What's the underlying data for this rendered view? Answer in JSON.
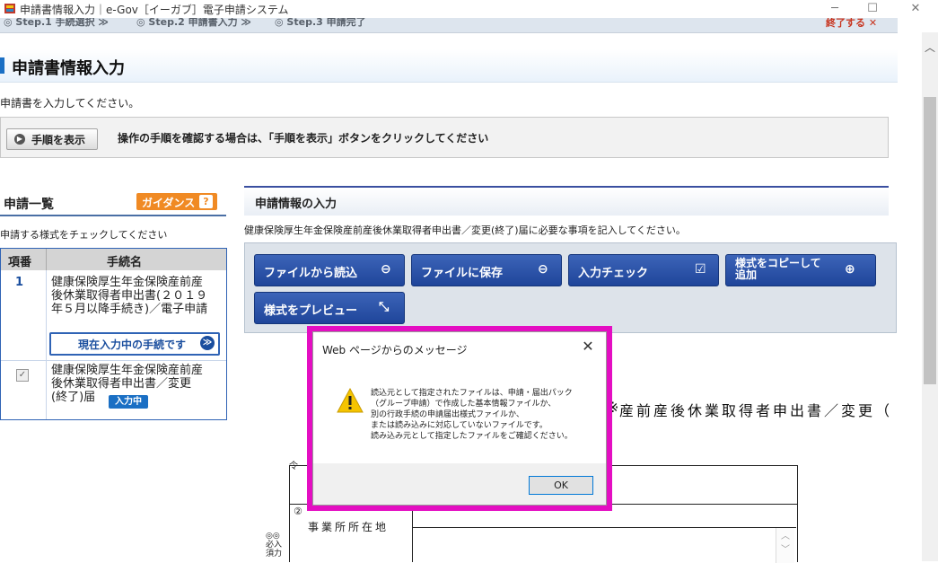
{
  "window": {
    "title": "申請書情報入力｜e-Gov［イーガブ］電子申請システム",
    "controls": {
      "minimize": "─",
      "maximize": "☐",
      "close": "✕"
    }
  },
  "steps": {
    "step1": "◎ Step.1 手続選択 ≫",
    "step2": "◎ Step.2 申請書入力 ≫",
    "step3": "◎ Step.3 申請完了",
    "logout": "終了する ✕"
  },
  "header": {
    "title": "申請書情報入力"
  },
  "subtitle": "申請書を入力してください。",
  "procedure": {
    "button_label": "手順を表示",
    "description": "操作の手順を確認する場合は、「手順を表示」ボタンをクリックしてください"
  },
  "left_panel": {
    "title": "申請一覧",
    "guidance_label": "ガイダンス",
    "guidance_icon": "?",
    "instruction": "申請する様式をチェックしてください",
    "columns": [
      "項番",
      "手続名"
    ],
    "rows": [
      {
        "num": "1",
        "lines": [
          "健康保険厚生年金保険産前産",
          "後休業取得者申出書(２０１９",
          "年５月以降手続き)／電子申請"
        ],
        "current_label": "現在入力中の手続です"
      },
      {
        "checked": true,
        "lines": [
          "健康保険厚生年金保険産前産",
          "後休業取得者申出書／変更",
          "(終了)届"
        ],
        "badge": "入力中"
      }
    ]
  },
  "right_panel": {
    "title": "申請情報の入力",
    "description": "健康保険厚生年金保険産前産後休業取得者申出書／変更(終了)届に必要な事項を記入してください。",
    "buttons": {
      "read_file": "ファイルから読込",
      "save_file": "ファイルに保存",
      "check_input": "入力チェック",
      "copy_form_line1": "様式をコピーして",
      "copy_form_line2": "追加",
      "preview": "様式をプレビュー"
    }
  },
  "document": {
    "heading": "産前産後休業取得者申出書／変更（",
    "heading_prefix": "※",
    "small_label": "令",
    "circle_num": "②",
    "row_label": "事業所所在地",
    "side_text": "◎◎必入須力"
  },
  "dialog": {
    "title": "Web ページからのメッセージ",
    "message": "読込元として指定されたファイルは、申請・届出パック\n（グループ申請）で作成した基本情報ファイルか、\n別の行政手続の申請届出様式ファイルか、\nまたは読み込みに対応していないファイルです。\n読み込み元として指定したファイルをご確認ください。",
    "ok_label": "OK",
    "close_icon": "✕"
  },
  "colors": {
    "highlight_frame": "#e40ec2",
    "primary_button": "#2a52a8",
    "guidance": "#f08a24"
  }
}
